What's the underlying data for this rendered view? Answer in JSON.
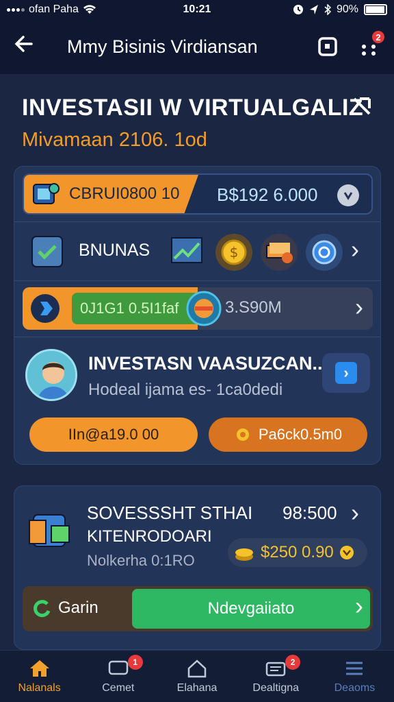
{
  "status_bar": {
    "carrier": "ofan Paha",
    "time": "10:21",
    "battery": "90%",
    "battery_level": 0.9
  },
  "app_bar": {
    "title": "Mmy Bisinis Virdiansan",
    "notification_count": "2"
  },
  "page": {
    "heading": "INVESTASII W VIRTUALGALIZ",
    "subtitle": "Mivamaan 2106. 1od"
  },
  "balance": {
    "label": "CBRUI0800 10",
    "value": "B$192 6.000"
  },
  "bonus": {
    "label": "BNUNAS"
  },
  "progress": {
    "label": "0J1G1 0.5I1faf",
    "value": "3.S90M",
    "fill_fraction": 0.5
  },
  "investment": {
    "title": "INVESTASN VAASUZCAN..",
    "subtitle": "Hodeal ijama es- 1ca0dedi",
    "button_1": "IIn@a19.0 00",
    "button_2": "Pa6ck0.5m0"
  },
  "service": {
    "title": "SOVESSSHT STHAI",
    "amount": "98:500",
    "subtitle": "KITENRODOARI",
    "note": "Nolkerha 0:1RO",
    "coin_value": "$250 0.90"
  },
  "action": {
    "left_label": "Garin",
    "main_label": "Ndevgaiiato"
  },
  "bottom_nav": [
    {
      "label": "Nalanals",
      "icon": "home-icon",
      "active": true
    },
    {
      "label": "Cemet",
      "icon": "chat-icon",
      "badge": "1"
    },
    {
      "label": "Elahana",
      "icon": "house-outline-icon"
    },
    {
      "label": "Dealtigna",
      "icon": "wallet-icon",
      "badge": "2"
    },
    {
      "label": "Deaoms",
      "icon": "menu-icon"
    }
  ],
  "colors": {
    "background": "#1a2642",
    "card": "#223458",
    "accent_orange": "#f2952a",
    "accent_green": "#2fb864",
    "accent_blue": "#2b8cf0",
    "badge_red": "#e53b3b"
  }
}
